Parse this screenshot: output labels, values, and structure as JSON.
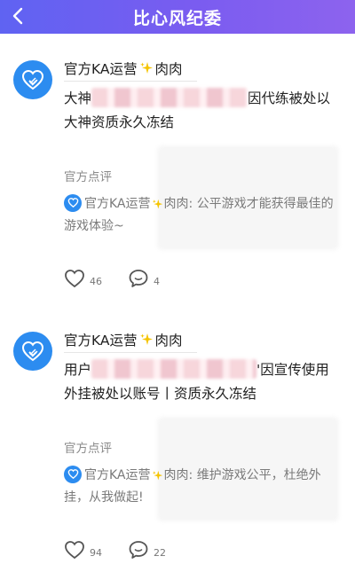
{
  "header": {
    "title": "比心风纪委",
    "background_colors": [
      "#5f63f2",
      "#8d63ee"
    ]
  },
  "posts": [
    {
      "author": "官方KA运营",
      "author_suffix": "肉肉",
      "content_before": "大神",
      "content_after": "因代练被处以大神资质永久冻结",
      "review_label": "官方点评",
      "reply_author": "官方KA运营",
      "reply_suffix": "肉肉:",
      "reply_text": "公平游戏才能获得最佳的游戏体验~",
      "likes": "46",
      "comments": "4"
    },
    {
      "author": "官方KA运营",
      "author_suffix": "肉肉",
      "content_before": "用户",
      "content_after": "'因宣传使用外挂被处以账号丨资质永久冻结",
      "review_label": "官方点评",
      "reply_author": "官方KA运营",
      "reply_suffix": "肉肉:",
      "reply_text": "维护游戏公平，杜绝外挂，从我做起!",
      "likes": "94",
      "comments": "22"
    }
  ],
  "icons": {
    "back": "chevron-left-icon",
    "avatar": "heart-badge-icon",
    "sparkle": "sparkle-icon",
    "like": "heart-outline-icon",
    "comment": "comment-bubble-icon"
  },
  "colors": {
    "avatar": "#2c8cf0",
    "sparkle": "#f5c400",
    "secondary_text": "#7a7a7a"
  }
}
